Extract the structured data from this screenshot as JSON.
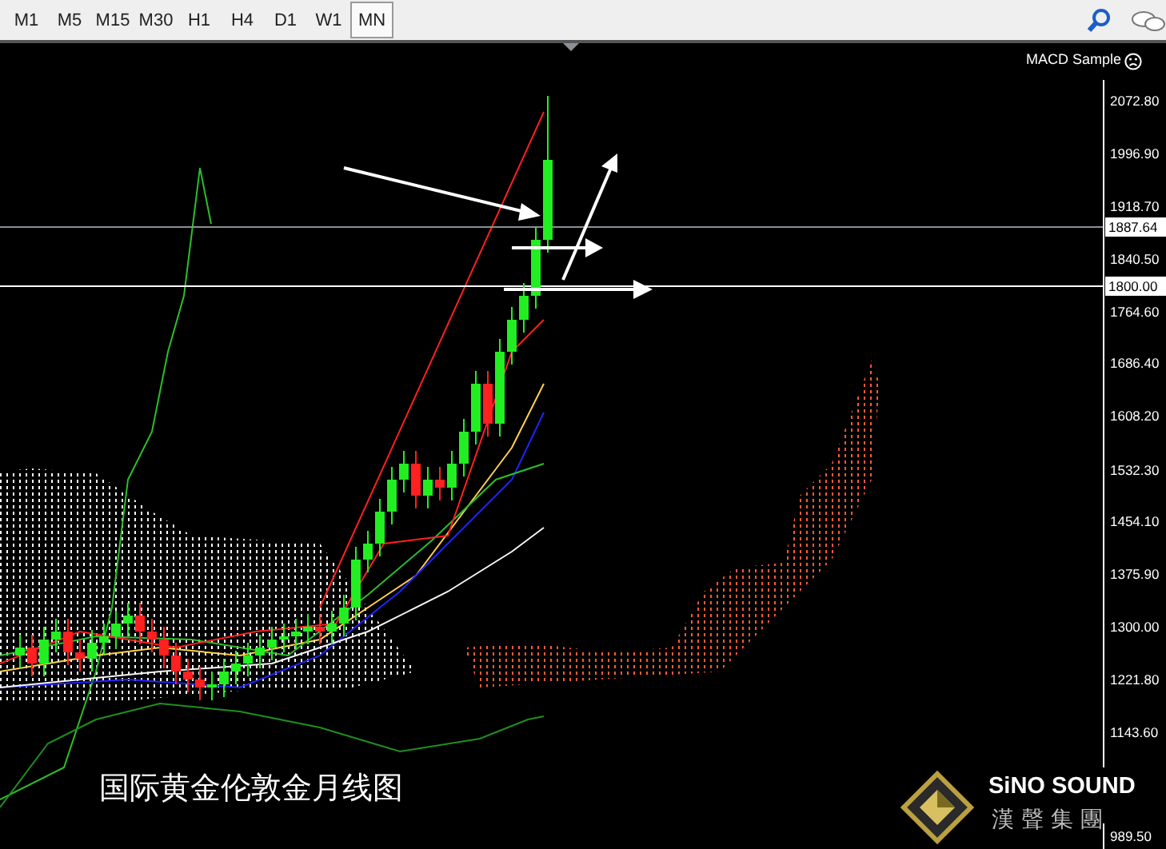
{
  "toolbar": {
    "timeframes": [
      {
        "label": "M1",
        "selected": false
      },
      {
        "label": "M5",
        "selected": false
      },
      {
        "label": "M15",
        "selected": false
      },
      {
        "label": "M30",
        "selected": false
      },
      {
        "label": "H1",
        "selected": false
      },
      {
        "label": "H4",
        "selected": false
      },
      {
        "label": "D1",
        "selected": false
      },
      {
        "label": "W1",
        "selected": false
      },
      {
        "label": "MN",
        "selected": true
      }
    ]
  },
  "chart": {
    "indicator_label": "MACD Sample",
    "price_axis": [
      "2072.80",
      "1996.90",
      "1918.70",
      "1840.50",
      "1764.60",
      "1686.40",
      "1608.20",
      "1532.30",
      "1454.10",
      "1375.90",
      "1300.00",
      "1221.80",
      "1143.60",
      "989.50"
    ],
    "price_lines": [
      {
        "label": "1887.64"
      },
      {
        "label": "1800.00"
      }
    ],
    "caption": "国际黄金伦敦金月线图"
  },
  "logo": {
    "name": "SiNO SOUND",
    "subtitle": "漢 聲 集 團"
  }
}
